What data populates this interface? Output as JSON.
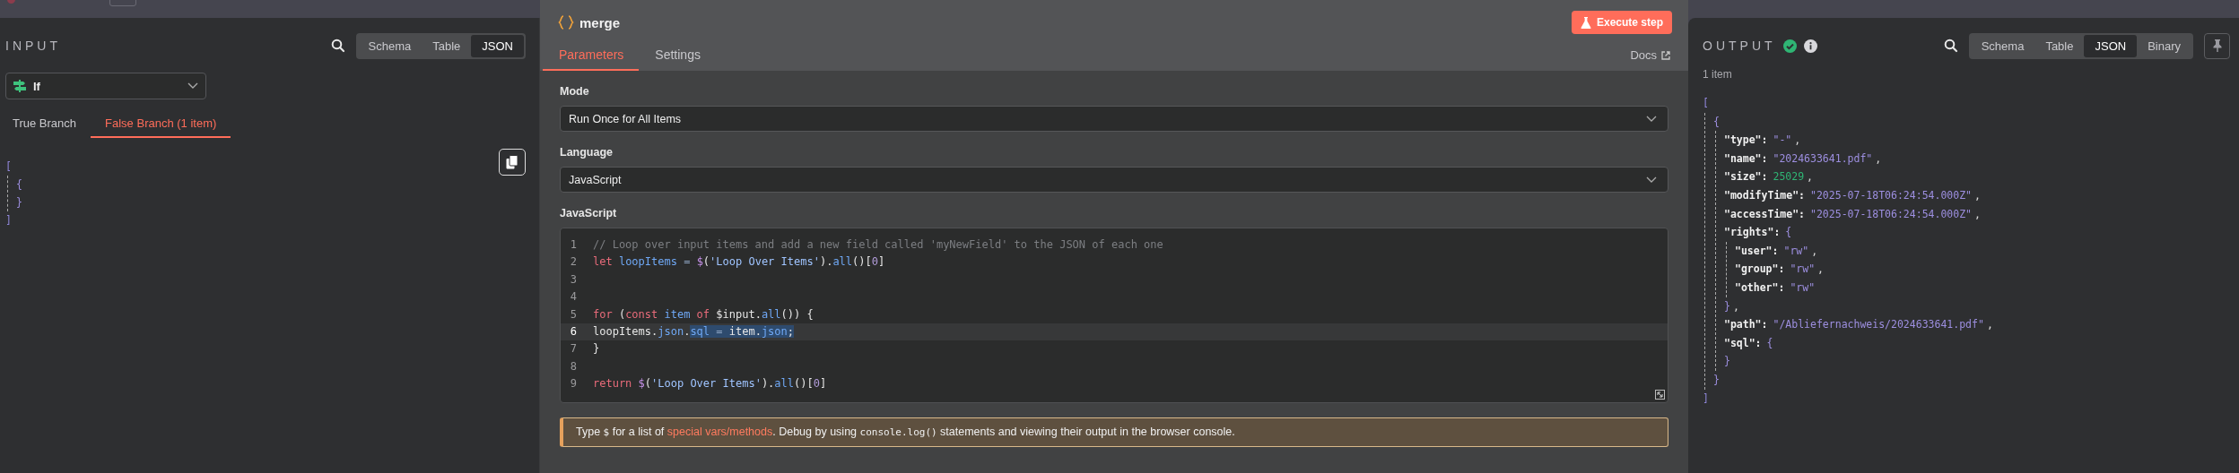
{
  "input_panel": {
    "title": "INPUT",
    "view_tabs": [
      {
        "label": "Schema",
        "selected": false
      },
      {
        "label": "Table",
        "selected": false
      },
      {
        "label": "JSON",
        "selected": true
      }
    ],
    "node_select": {
      "value": "If"
    },
    "branches": [
      {
        "label": "True Branch",
        "selected": false
      },
      {
        "label": "False Branch (1 item)",
        "selected": true
      }
    ],
    "json": {
      "kind": "array",
      "open": "[",
      "close": "]",
      "children": [
        {
          "kind": "object",
          "open": "{",
          "close": "}"
        }
      ]
    }
  },
  "node_panel": {
    "title": "merge",
    "execute_button": "Execute step",
    "tabs": [
      {
        "label": "Parameters",
        "selected": true
      },
      {
        "label": "Settings",
        "selected": false
      }
    ],
    "docs_link": "Docs",
    "mode": {
      "label": "Mode",
      "value": "Run Once for All Items"
    },
    "language": {
      "label": "Language",
      "value": "JavaScript"
    },
    "code": {
      "label": "JavaScript",
      "lines": [
        {
          "number": "1",
          "active": false,
          "tokens": [
            {
              "text": "// Loop over input items and add a new field called 'myNewField' to the JSON of each one",
              "kind": "comment",
              "selected": false
            }
          ]
        },
        {
          "number": "2",
          "active": false,
          "tokens": [
            {
              "text": "let",
              "kind": "keyword",
              "selected": false
            },
            {
              "text": " loopItems",
              "kind": "variable",
              "selected": false
            },
            {
              "text": " = ",
              "kind": "operator",
              "selected": false
            },
            {
              "text": "$",
              "kind": "special",
              "selected": false
            },
            {
              "text": "(",
              "kind": "plain",
              "selected": false
            },
            {
              "text": "'Loop Over Items'",
              "kind": "string",
              "selected": false
            },
            {
              "text": ").",
              "kind": "plain",
              "selected": false
            },
            {
              "text": "all",
              "kind": "property",
              "selected": false
            },
            {
              "text": "()[",
              "kind": "plain",
              "selected": false
            },
            {
              "text": "0",
              "kind": "number",
              "selected": false
            },
            {
              "text": "]",
              "kind": "plain",
              "selected": false
            }
          ]
        },
        {
          "number": "3",
          "active": false
        },
        {
          "number": "4",
          "active": false
        },
        {
          "number": "5",
          "active": false,
          "tokens": [
            {
              "text": "for",
              "kind": "keyword",
              "selected": false
            },
            {
              "text": " (",
              "kind": "plain",
              "selected": false
            },
            {
              "text": "const",
              "kind": "keyword",
              "selected": false
            },
            {
              "text": " item",
              "kind": "variable",
              "selected": false
            },
            {
              "text": " of",
              "kind": "keyword",
              "selected": false
            },
            {
              "text": " $input.",
              "kind": "plain",
              "selected": false
            },
            {
              "text": "all",
              "kind": "property",
              "selected": false
            },
            {
              "text": "()) {",
              "kind": "plain",
              "selected": false
            }
          ]
        },
        {
          "number": "6",
          "active": true,
          "tokens": [
            {
              "text": "loopItems.",
              "kind": "plain",
              "selected": false
            },
            {
              "text": "json",
              "kind": "property",
              "selected": false
            },
            {
              "text": ".",
              "kind": "plain",
              "selected": false
            },
            {
              "text": "sql",
              "kind": "property",
              "selected": true
            },
            {
              "text": " = ",
              "kind": "operator",
              "selected": true
            },
            {
              "text": "item.",
              "kind": "plain",
              "selected": true
            },
            {
              "text": "json",
              "kind": "property",
              "selected": true
            },
            {
              "text": ";",
              "kind": "plain",
              "selected": true
            }
          ]
        },
        {
          "number": "7",
          "active": false,
          "tokens": [
            {
              "text": "}",
              "kind": "plain",
              "selected": false
            }
          ]
        },
        {
          "number": "8",
          "active": false
        },
        {
          "number": "9",
          "active": false,
          "tokens": [
            {
              "text": "return",
              "kind": "keyword",
              "selected": false
            },
            {
              "text": " $",
              "kind": "special",
              "selected": false
            },
            {
              "text": "(",
              "kind": "plain",
              "selected": false
            },
            {
              "text": "'Loop Over Items'",
              "kind": "string",
              "selected": false
            },
            {
              "text": ").",
              "kind": "plain",
              "selected": false
            },
            {
              "text": "all",
              "kind": "property",
              "selected": false
            },
            {
              "text": "()[",
              "kind": "plain",
              "selected": false
            },
            {
              "text": "0",
              "kind": "number",
              "selected": false
            },
            {
              "text": "]",
              "kind": "plain",
              "selected": false
            }
          ]
        }
      ]
    },
    "notice": {
      "parts": [
        {
          "kind": "text",
          "text": "Type "
        },
        {
          "kind": "code",
          "text": "$"
        },
        {
          "kind": "text",
          "text": " for a list of "
        },
        {
          "kind": "link",
          "text": "special vars/methods"
        },
        {
          "kind": "text",
          "text": ". Debug by using "
        },
        {
          "kind": "code",
          "text": "console.log()"
        },
        {
          "kind": "text",
          "text": " statements and viewing their output in the browser console."
        }
      ]
    }
  },
  "output_panel": {
    "title": "OUTPUT",
    "success": true,
    "view_tabs": [
      {
        "label": "Schema",
        "selected": false
      },
      {
        "label": "Table",
        "selected": false
      },
      {
        "label": "JSON",
        "selected": true
      },
      {
        "label": "Binary",
        "selected": false
      }
    ],
    "item_count": "1 item",
    "json": {
      "kind": "array",
      "open": "[",
      "close": "]",
      "children": [
        {
          "kind": "object",
          "open": "{",
          "close": "}",
          "children": [
            {
              "kind": "string",
              "key": "\"type\":",
              "value": "\"-\"",
              "tail": ","
            },
            {
              "kind": "string",
              "key": "\"name\":",
              "value": "\"2024633641.pdf\"",
              "tail": ","
            },
            {
              "kind": "number",
              "key": "\"size\":",
              "value": "25029",
              "tail": ","
            },
            {
              "kind": "string",
              "key": "\"modifyTime\":",
              "value": "\"2025-07-18T06:24:54.000Z\"",
              "tail": ","
            },
            {
              "kind": "string",
              "key": "\"accessTime\":",
              "value": "\"2025-07-18T06:24:54.000Z\"",
              "tail": ","
            },
            {
              "kind": "object",
              "key": "\"rights\":",
              "open": "{",
              "close": "}",
              "tail": ",",
              "children": [
                {
                  "kind": "string",
                  "key": "\"user\":",
                  "value": "\"rw\"",
                  "tail": ","
                },
                {
                  "kind": "string",
                  "key": "\"group\":",
                  "value": "\"rw\"",
                  "tail": ","
                },
                {
                  "kind": "string",
                  "key": "\"other\":",
                  "value": "\"rw\""
                }
              ]
            },
            {
              "kind": "string",
              "key": "\"path\":",
              "value": "\"/Abliefernachweis/2024633641.pdf\"",
              "tail": ","
            },
            {
              "kind": "object",
              "key": "\"sql\":",
              "open": "{",
              "close": "}"
            }
          ]
        }
      ]
    }
  }
}
